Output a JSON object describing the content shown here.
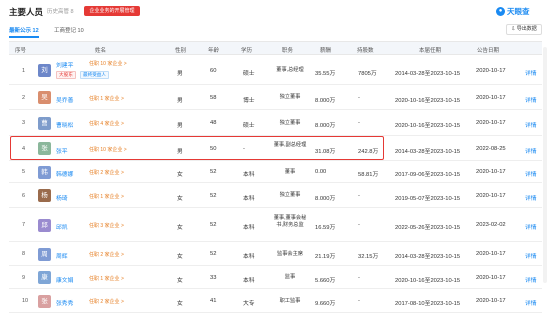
{
  "header": {
    "title": "主要人员",
    "history_label": "历史高管 8",
    "badge": "企业业务的开展管理",
    "logo_text": "天眼查"
  },
  "tabs": [
    {
      "label": "最新公示 12",
      "active": true
    },
    {
      "label": "工商登记 10",
      "active": false
    }
  ],
  "export_label": "导出数据",
  "columns": [
    "序号",
    "姓名",
    "性别",
    "年龄",
    "学历",
    "职务",
    "薪酬",
    "持股数",
    "本届任期",
    "公告日期",
    ""
  ],
  "rows": [
    {
      "no": "1",
      "avatar": "刘",
      "avatar_color": "#6d87c9",
      "name": "刘建平",
      "tag": "任职 10 家企业 >",
      "badges": [
        "大股东",
        "最终受益人"
      ],
      "sex": "男",
      "age": "60",
      "edu": "硕士",
      "position": "董事,总经理",
      "salary": "35.55万",
      "holding": "7805万",
      "term": "2014-03-28至2023-10-15",
      "date": "2020-10-17",
      "detail": "详情"
    },
    {
      "no": "2",
      "avatar": "吴",
      "avatar_color": "#d98e6e",
      "name": "吴乔善",
      "tag": "任职 1 家企业 >",
      "badges": [],
      "sex": "男",
      "age": "58",
      "edu": "博士",
      "position": "独立董事",
      "salary": "8.000万",
      "holding": "-",
      "term": "2020-10-16至2023-10-15",
      "date": "2020-10-17",
      "detail": "详情"
    },
    {
      "no": "3",
      "avatar": "曹",
      "avatar_color": "#7e9ccb",
      "name": "曹晓松",
      "tag": "任职 4 家企业 >",
      "badges": [],
      "sex": "男",
      "age": "48",
      "edu": "硕士",
      "position": "独立董事",
      "salary": "8.000万",
      "holding": "-",
      "term": "2020-10-16至2023-10-15",
      "date": "2020-10-17",
      "detail": "详情"
    },
    {
      "no": "4",
      "avatar": "张",
      "avatar_color": "#8bb79b",
      "name": "张平",
      "tag": "任职 10 家企业 >",
      "badges": [],
      "sex": "男",
      "age": "50",
      "edu": "-",
      "position": "董事,副总经理",
      "salary": "31.08万",
      "holding": "242.8万",
      "term": "2014-03-28至2023-10-15",
      "date": "2022-08-25",
      "detail": "详情"
    },
    {
      "no": "5",
      "avatar": "韩",
      "avatar_color": "#7f9bd4",
      "name": "韩德娜",
      "tag": "任职 2 家企业 >",
      "badges": [],
      "sex": "女",
      "age": "52",
      "edu": "本科",
      "position": "董事",
      "salary": "0.00",
      "holding": "58.81万",
      "term": "2017-09-06至2023-10-15",
      "date": "2020-10-17",
      "detail": "详情"
    },
    {
      "no": "6",
      "avatar": "杨",
      "avatar_color": "#9a6b4c",
      "name": "杨琦",
      "tag": "任职 1 家企业 >",
      "badges": [],
      "sex": "女",
      "age": "52",
      "edu": "本科",
      "position": "独立董事",
      "salary": "8.000万",
      "holding": "-",
      "term": "2019-05-07至2023-10-15",
      "date": "2020-10-17",
      "detail": "详情"
    },
    {
      "no": "7",
      "avatar": "邱",
      "avatar_color": "#9a8bcf",
      "name": "邱凯",
      "tag": "任职 3 家企业 >",
      "badges": [],
      "sex": "女",
      "age": "52",
      "edu": "本科",
      "position": "董事,董事会秘书,财务总监",
      "salary": "16.59万",
      "holding": "-",
      "term": "2022-05-26至2023-10-15",
      "date": "2023-02-02",
      "detail": "详情"
    },
    {
      "no": "8",
      "avatar": "周",
      "avatar_color": "#7f9bd4",
      "name": "周辉",
      "tag": "任职 2 家企业 >",
      "badges": [],
      "sex": "女",
      "age": "52",
      "edu": "本科",
      "position": "监事会主席",
      "salary": "21.19万",
      "holding": "32.15万",
      "term": "2014-03-28至2023-10-15",
      "date": "2020-10-17",
      "detail": "详情"
    },
    {
      "no": "9",
      "avatar": "康",
      "avatar_color": "#7fa6d6",
      "name": "康文娟",
      "tag": "任职 1 家企业 >",
      "badges": [],
      "sex": "女",
      "age": "33",
      "edu": "本科",
      "position": "监事",
      "salary": "5.660万",
      "holding": "-",
      "term": "2020-10-16至2023-10-15",
      "date": "2020-10-17",
      "detail": "详情"
    },
    {
      "no": "10",
      "avatar": "张",
      "avatar_color": "#d9a0a0",
      "name": "张秀秀",
      "tag": "任职 2 家企业 >",
      "badges": [],
      "sex": "女",
      "age": "41",
      "edu": "大专",
      "position": "职工监事",
      "salary": "9.660万",
      "holding": "-",
      "term": "2017-08-10至2023-10-15",
      "date": "2020-10-17",
      "detail": "详情"
    }
  ]
}
